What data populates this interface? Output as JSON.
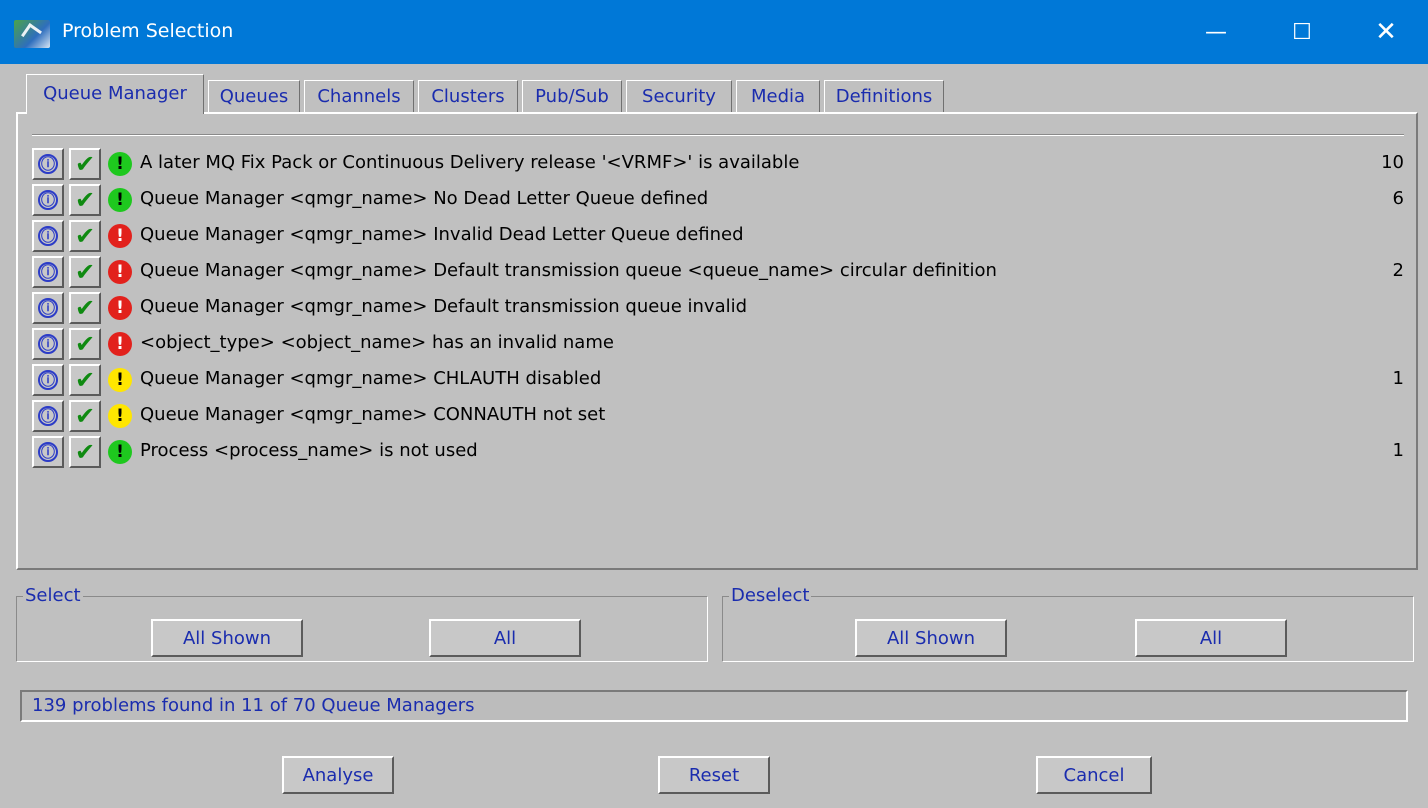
{
  "window": {
    "title": "Problem Selection",
    "minimize": "—",
    "maximize": "☐",
    "close": "✕"
  },
  "tabs": [
    {
      "label": "Queue Manager",
      "active": true
    },
    {
      "label": "Queues"
    },
    {
      "label": "Channels"
    },
    {
      "label": "Clusters"
    },
    {
      "label": "Pub/Sub"
    },
    {
      "label": "Security"
    },
    {
      "label": "Media"
    },
    {
      "label": "Definitions"
    }
  ],
  "problems": [
    {
      "severity": "green",
      "text": "A later MQ Fix Pack or Continuous Delivery release '<VRMF>' is available",
      "count": "10"
    },
    {
      "severity": "green",
      "text": "Queue Manager <qmgr_name> No Dead Letter Queue defined",
      "count": "6"
    },
    {
      "severity": "red",
      "text": "Queue Manager <qmgr_name> Invalid Dead Letter Queue defined",
      "count": ""
    },
    {
      "severity": "red",
      "text": "Queue Manager <qmgr_name> Default transmission queue <queue_name> circular definition",
      "count": "2"
    },
    {
      "severity": "red",
      "text": "Queue Manager <qmgr_name> Default transmission queue invalid",
      "count": ""
    },
    {
      "severity": "red",
      "text": "<object_type> <object_name> has an invalid name",
      "count": ""
    },
    {
      "severity": "yellow",
      "text": "Queue Manager <qmgr_name> CHLAUTH disabled",
      "count": "1"
    },
    {
      "severity": "yellow",
      "text": "Queue Manager <qmgr_name> CONNAUTH not set",
      "count": ""
    },
    {
      "severity": "green",
      "text": "Process <process_name> is not used",
      "count": "1"
    }
  ],
  "icons": {
    "info": "ⓘ",
    "check": "✔",
    "severity": "!"
  },
  "select": {
    "legend": "Select",
    "all_shown": "All Shown",
    "all": "All"
  },
  "deselect": {
    "legend": "Deselect",
    "all_shown": "All Shown",
    "all": "All"
  },
  "status": "139 problems found in 11 of 70 Queue Managers",
  "actions": {
    "analyse": "Analyse",
    "reset": "Reset",
    "cancel": "Cancel"
  },
  "colors": {
    "titlebar": "#0078d7",
    "accent_text": "#1a2cae",
    "background": "#c0c0c0"
  }
}
